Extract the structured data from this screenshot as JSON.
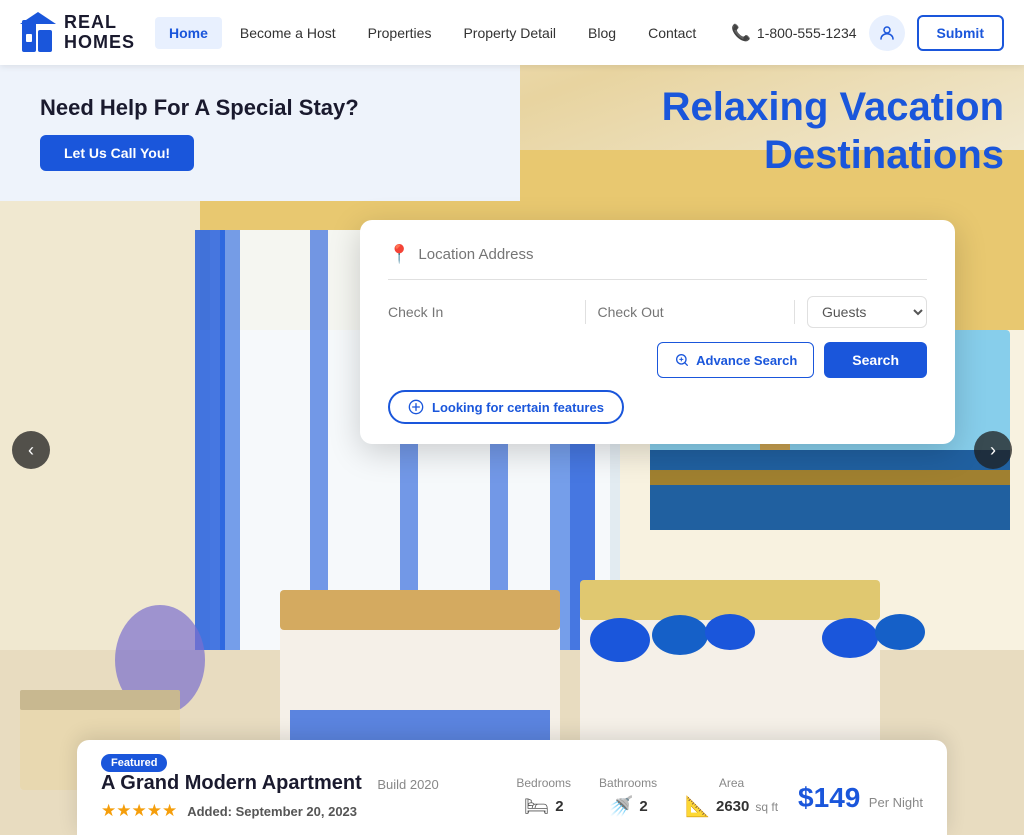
{
  "header": {
    "logo": {
      "real": "REAL",
      "homes": "HOMES"
    },
    "nav": [
      {
        "label": "Home",
        "active": true
      },
      {
        "label": "Become a Host",
        "active": false
      },
      {
        "label": "Properties",
        "active": false
      },
      {
        "label": "Property Detail",
        "active": false
      },
      {
        "label": "Blog",
        "active": false
      },
      {
        "label": "Contact",
        "active": false
      }
    ],
    "phone": "1-800-555-1234",
    "submit_label": "Submit"
  },
  "promo": {
    "headline": "Need Help For A Special Stay?",
    "cta": "Let Us Call You!"
  },
  "hero": {
    "headline": "Relaxing Vacation Destinations"
  },
  "search": {
    "location_placeholder": "Location Address",
    "checkin_placeholder": "Check In",
    "checkout_placeholder": "Check Out",
    "guests_placeholder": "Guests",
    "advance_search_label": "Advance Search",
    "search_label": "Search",
    "features_label": "Looking for certain features"
  },
  "property": {
    "featured_badge": "Featured",
    "title": "A Grand Modern Apartment",
    "build_year": "Build 2020",
    "rating_stars": 5,
    "added_label": "Added:",
    "added_date": "September 20, 2023",
    "stats": {
      "bedrooms_label": "Bedrooms",
      "bedrooms_value": "2",
      "bathrooms_label": "Bathrooms",
      "bathrooms_value": "2",
      "area_label": "Area",
      "area_value": "2630",
      "area_unit": "sq ft"
    },
    "price": "$149",
    "price_per": "Per Night"
  },
  "colors": {
    "primary": "#1a56db",
    "star": "#f59e0b"
  }
}
